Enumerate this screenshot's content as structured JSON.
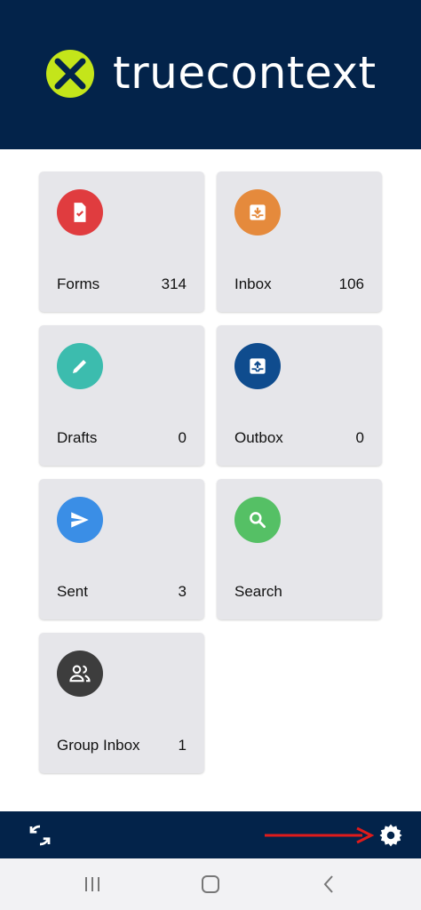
{
  "header": {
    "brand": "truecontext"
  },
  "tiles": [
    {
      "label": "Forms",
      "count": "314",
      "icon": "form-check-icon",
      "color": "#e03c3f"
    },
    {
      "label": "Inbox",
      "count": "106",
      "icon": "inbox-download-icon",
      "color": "#e58a3c"
    },
    {
      "label": "Drafts",
      "count": "0",
      "icon": "pencil-icon",
      "color": "#3cbcae"
    },
    {
      "label": "Outbox",
      "count": "0",
      "icon": "outbox-upload-icon",
      "color": "#0f4c8e"
    },
    {
      "label": "Sent",
      "count": "3",
      "icon": "send-icon",
      "color": "#3a8ee6"
    },
    {
      "label": "Search",
      "count": "",
      "icon": "search-icon",
      "color": "#55c065"
    },
    {
      "label": "Group Inbox",
      "count": "1",
      "icon": "group-icon",
      "color": "#3d3d3d"
    }
  ],
  "bottom_bar": {
    "left_icon": "sync-icon",
    "right_icon": "settings-gear-icon",
    "annotation_color": "#e01b1b"
  },
  "system_nav": {
    "icons": [
      "recent-apps-icon",
      "home-icon",
      "back-icon"
    ]
  }
}
